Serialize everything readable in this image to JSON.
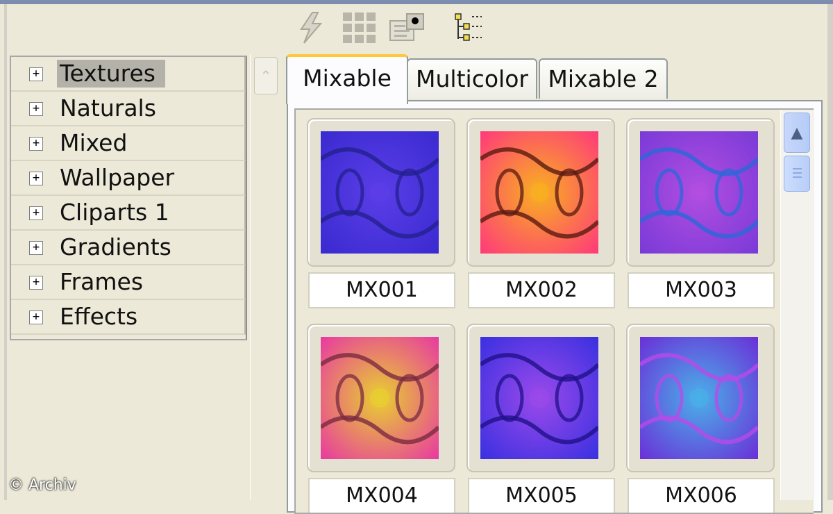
{
  "toolbar": {
    "buttons": [
      {
        "icon": "lightning-icon"
      },
      {
        "icon": "grid-icon"
      },
      {
        "icon": "image-folder-icon"
      },
      {
        "icon": "tree-icon"
      }
    ]
  },
  "categories": [
    {
      "label": "Textures",
      "expander": "+",
      "selected": true
    },
    {
      "label": "Naturals",
      "expander": "+"
    },
    {
      "label": "Mixed",
      "expander": "+"
    },
    {
      "label": "Wallpaper",
      "expander": "+"
    },
    {
      "label": "Cliparts 1",
      "expander": "+"
    },
    {
      "label": "Gradients",
      "expander": "+"
    },
    {
      "label": "Frames",
      "expander": "+"
    },
    {
      "label": "Effects",
      "expander": "+"
    }
  ],
  "tabs": [
    {
      "label": "Mixable",
      "active": true
    },
    {
      "label": "Multicolor"
    },
    {
      "label": "Mixable 2"
    }
  ],
  "tiles": [
    {
      "label": "MX001",
      "colors": [
        "#3a2ad0",
        "#5b3ee8",
        "#23208f"
      ]
    },
    {
      "label": "MX002",
      "colors": [
        "#ff3a7a",
        "#f8b020",
        "#5a1a10"
      ]
    },
    {
      "label": "MX003",
      "colors": [
        "#7a3ad8",
        "#b24ee0",
        "#2a68d8"
      ]
    },
    {
      "label": "MX004",
      "colors": [
        "#e83aa0",
        "#e8d030",
        "#7a2a40"
      ]
    },
    {
      "label": "MX005",
      "colors": [
        "#3a30e0",
        "#9b4aea",
        "#20108a"
      ]
    },
    {
      "label": "MX006",
      "colors": [
        "#6a30d8",
        "#4ab0e8",
        "#b84ae8"
      ]
    }
  ],
  "watermark": "© Archiv"
}
